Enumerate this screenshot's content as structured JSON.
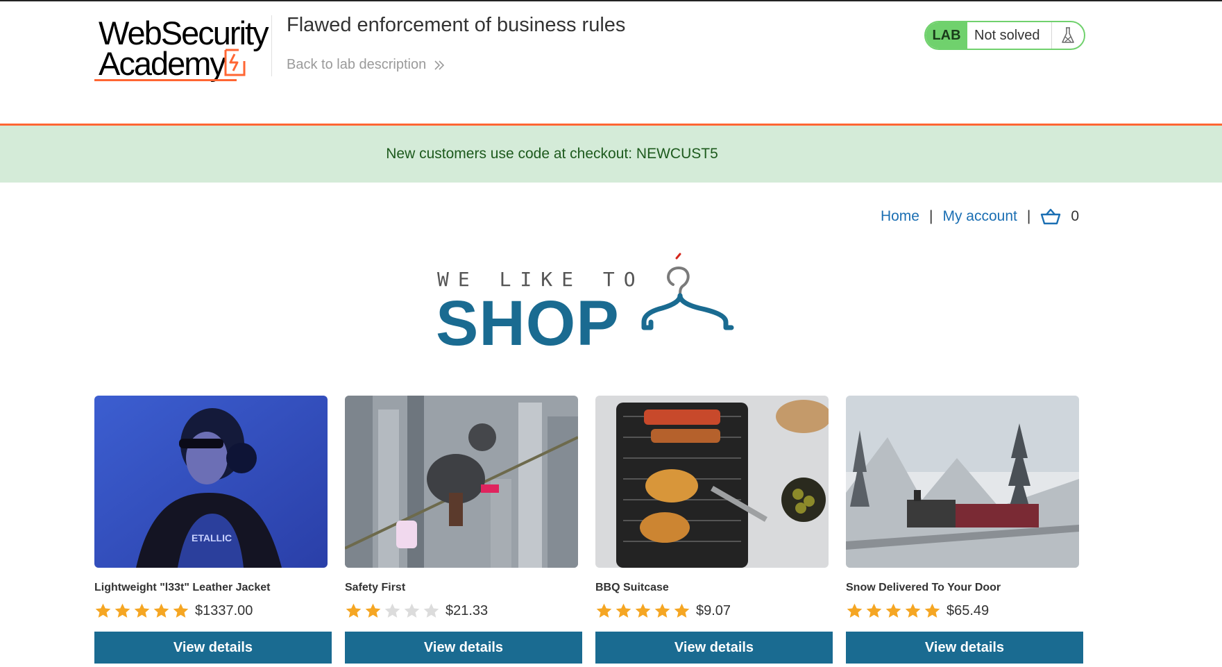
{
  "header": {
    "logo_line1": "WebSecurity",
    "logo_line2": "Academy",
    "lab_title": "Flawed enforcement of business rules",
    "back_link": "Back to lab description",
    "lab_badge": "LAB",
    "lab_status": "Not solved"
  },
  "banner": {
    "message": "New customers use code at checkout: NEWCUST5"
  },
  "nav": {
    "home": "Home",
    "separator": "|",
    "my_account": "My account",
    "cart_count": "0"
  },
  "hero": {
    "small_text": "WE LIKE TO",
    "big_text": "SHOP"
  },
  "products": [
    {
      "name": "Lightweight \"l33t\" Leather Jacket",
      "rating": 5,
      "price": "$1337.00",
      "button": "View details"
    },
    {
      "name": "Safety First",
      "rating": 2,
      "price": "$21.33",
      "button": "View details"
    },
    {
      "name": "BBQ Suitcase",
      "rating": 5,
      "price": "$9.07",
      "button": "View details"
    },
    {
      "name": "Snow Delivered To Your Door",
      "rating": 5,
      "price": "$65.49",
      "button": "View details"
    }
  ],
  "colors": {
    "accent_orange": "#ff6633",
    "lab_green": "#70d16d",
    "banner_bg": "#d4ebd8",
    "banner_text": "#1d5a1d",
    "brand_blue": "#1a6b91",
    "link_blue": "#1b6fb3",
    "star_filled": "#f5a623",
    "star_empty": "#dcdcdc"
  },
  "icons": {
    "back_link": "double-chevron-right-icon",
    "lab_status": "flask-icon",
    "cart": "basket-icon",
    "hero": "clothes-hanger-icon",
    "rating": "star-icon"
  }
}
